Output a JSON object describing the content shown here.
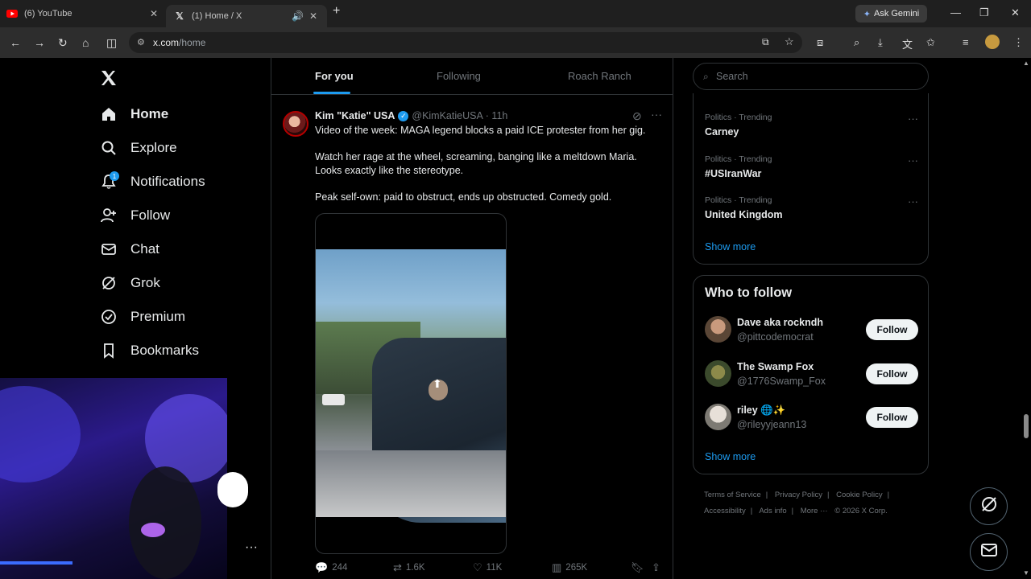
{
  "browser": {
    "tabs": [
      {
        "title": "(6) YouTube",
        "icon": "youtube-icon",
        "active": false
      },
      {
        "title": "(1) Home / X",
        "icon": "x-logo-icon",
        "active": true
      }
    ],
    "ask_gemini": "Ask Gemini",
    "url_host": "x.com",
    "url_path": "/home"
  },
  "sidebar": {
    "items": [
      {
        "label": "Home",
        "icon": "home-icon"
      },
      {
        "label": "Explore",
        "icon": "search-icon"
      },
      {
        "label": "Notifications",
        "icon": "bell-icon",
        "badge": "1"
      },
      {
        "label": "Follow",
        "icon": "person-add-icon"
      },
      {
        "label": "Chat",
        "icon": "mail-icon"
      },
      {
        "label": "Grok",
        "icon": "grok-icon"
      },
      {
        "label": "Premium",
        "icon": "verified-badge-icon"
      },
      {
        "label": "Bookmarks",
        "icon": "bookmark-icon"
      }
    ]
  },
  "feed": {
    "tabs": [
      {
        "label": "For you",
        "active": true
      },
      {
        "label": "Following",
        "active": false
      },
      {
        "label": "Roach Ranch",
        "active": false
      }
    ]
  },
  "tweet": {
    "name": "Kim \"Katie\" USA",
    "handle": "@KimKatieUSA",
    "time": "· 11h",
    "lines": [
      "Video of the week: MAGA legend blocks a paid ICE protester from her gig.",
      "Watch her rage at the wheel, screaming, banging like a meltdown Maria. Looks exactly like the stereotype.",
      "Peak self-own: paid to obstruct, ends up obstructed. Comedy gold."
    ],
    "replies": "244",
    "reposts": "1.6K",
    "likes": "11K",
    "views": "265K"
  },
  "search": {
    "placeholder": "Search"
  },
  "trends": {
    "items": [
      {
        "category": "Politics · Trending",
        "name": "Carney"
      },
      {
        "category": "Politics · Trending",
        "name": "#USIranWar"
      },
      {
        "category": "Politics · Trending",
        "name": "United Kingdom"
      }
    ],
    "show_more": "Show more"
  },
  "who_to_follow": {
    "title": "Who to follow",
    "users": [
      {
        "name": "Dave aka rockndh",
        "handle": "@pittcodemocrat",
        "button": "Follow"
      },
      {
        "name": "The Swamp Fox",
        "handle": "@1776Swamp_Fox",
        "button": "Follow"
      },
      {
        "name": "riley 🌐✨",
        "handle": "@rileyyjeann13",
        "button": "Follow"
      }
    ],
    "show_more": "Show more"
  },
  "footer": {
    "links": [
      "Terms of Service",
      "Privacy Policy",
      "Cookie Policy",
      "Accessibility",
      "Ads info",
      "More ···"
    ],
    "copyright": "© 2026 X Corp."
  },
  "colors": {
    "accent": "#1d9bf0",
    "background": "#000000",
    "text": "#e7e9ea",
    "muted": "#71767b",
    "border": "#2f3336"
  }
}
